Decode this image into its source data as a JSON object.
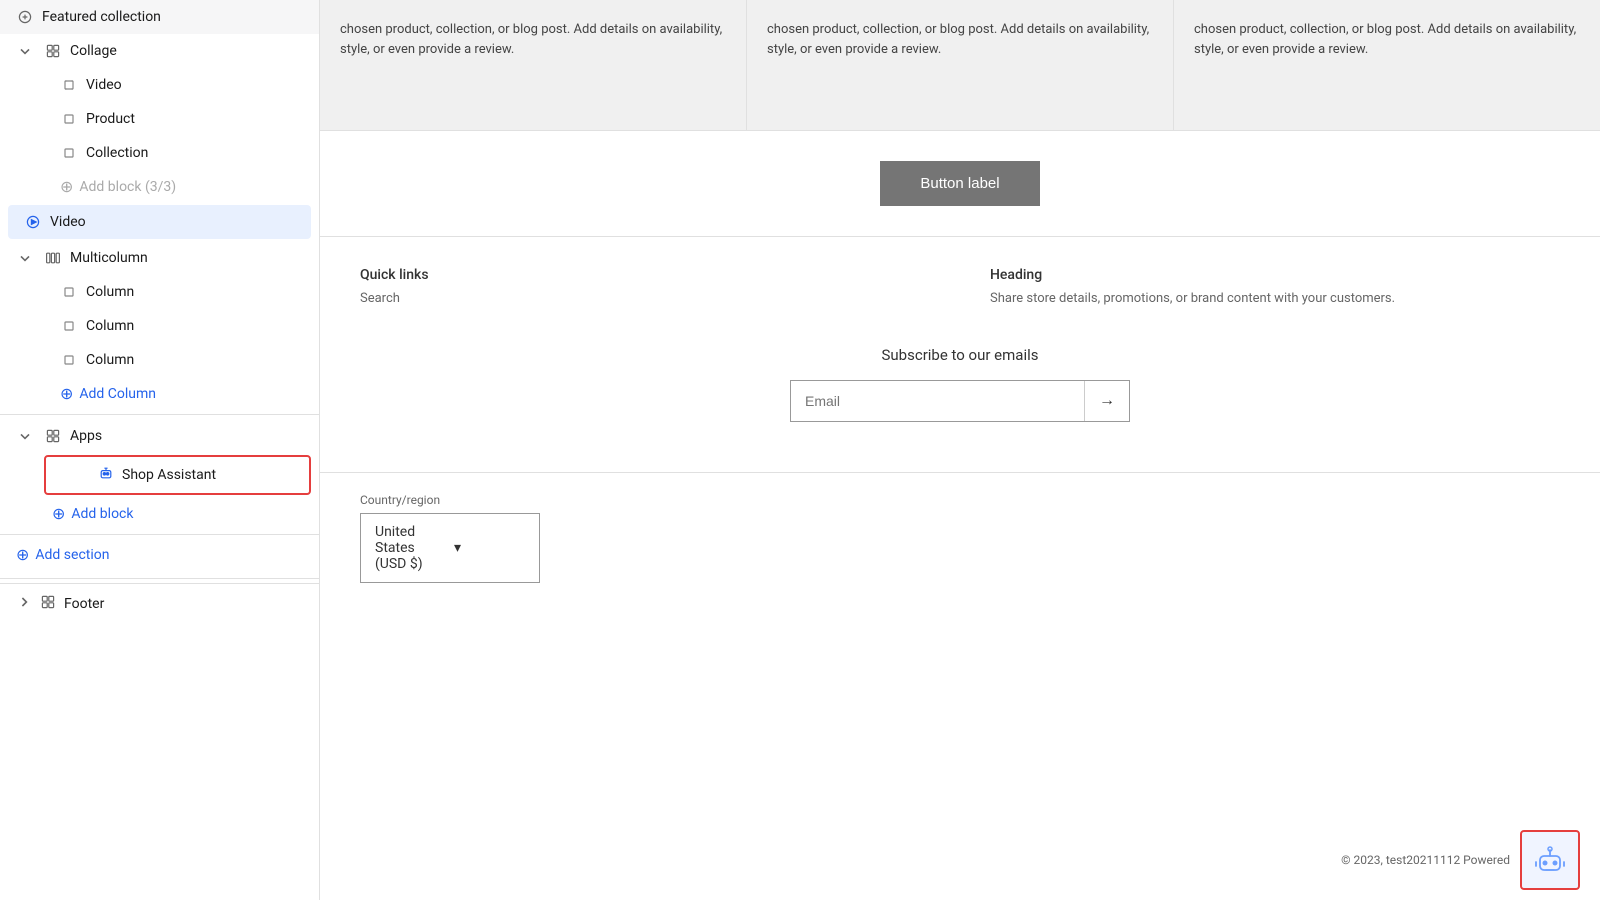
{
  "sidebar": {
    "featured_collection": "Featured collection",
    "collage": "Collage",
    "video_child": "Video",
    "product_child": "Product",
    "collection_child": "Collection",
    "add_block_label": "Add block (3/3)",
    "video_section": "Video",
    "multicolumn": "Multicolumn",
    "column1": "Column",
    "column2": "Column",
    "column3": "Column",
    "add_column": "Add Column",
    "apps": "Apps",
    "shop_assistant": "Shop Assistant",
    "add_block": "Add block",
    "add_section": "Add section",
    "footer": "Footer"
  },
  "main": {
    "card_text": "chosen product, collection, or blog post. Add details on availability, style, or even provide a review.",
    "button_label": "Button label",
    "quick_links": "Quick links",
    "search_link": "Search",
    "heading": "Heading",
    "heading_desc": "Share store details, promotions, or brand content with your customers.",
    "subscribe_title": "Subscribe to our emails",
    "email_placeholder": "Email",
    "country_label": "Country/region",
    "country_value": "United States (USD $)",
    "copyright": "© 2023, test20211112 Powered"
  }
}
